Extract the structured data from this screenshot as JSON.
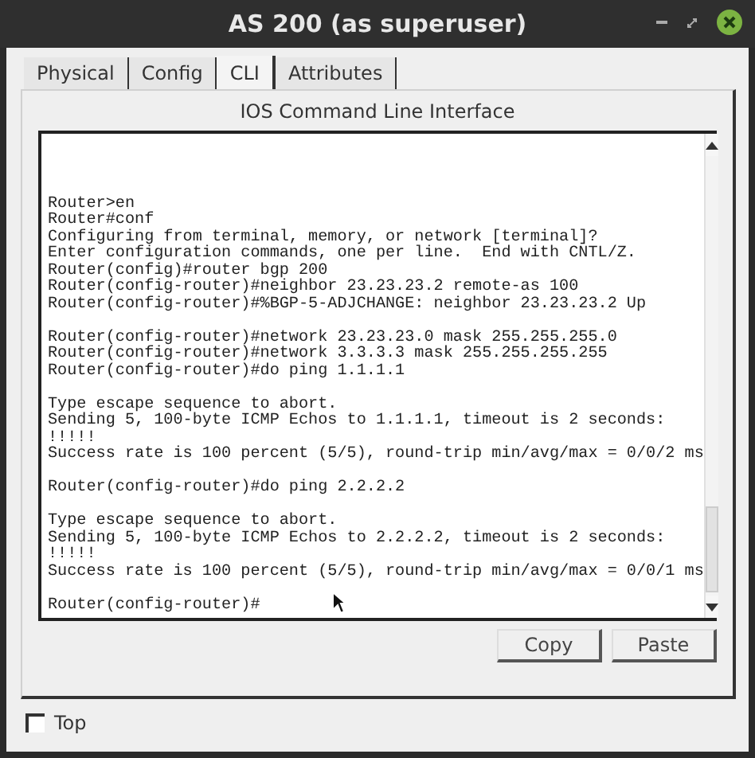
{
  "window": {
    "title": "AS 200 (as superuser)"
  },
  "tabs": [
    {
      "label": "Physical",
      "selected": false
    },
    {
      "label": "Config",
      "selected": false
    },
    {
      "label": "CLI",
      "selected": true
    },
    {
      "label": "Attributes",
      "selected": false
    }
  ],
  "cli": {
    "heading": "IOS Command Line Interface",
    "paragraphs": [
      [
        "Router>en",
        "Router#conf",
        "Configuring from terminal, memory, or network [terminal]?",
        "Enter configuration commands, one per line.  End with CNTL/Z.",
        "Router(config)#router bgp 200",
        "Router(config-router)#neighbor 23.23.23.2 remote-as 100",
        "Router(config-router)#%BGP-5-ADJCHANGE: neighbor 23.23.23.2 Up"
      ],
      [
        "Router(config-router)#network 23.23.23.0 mask 255.255.255.0",
        "Router(config-router)#network 3.3.3.3 mask 255.255.255.255",
        "Router(config-router)#do ping 1.1.1.1"
      ],
      [
        "Type escape sequence to abort.",
        "Sending 5, 100-byte ICMP Echos to 1.1.1.1, timeout is 2 seconds:",
        "!!!!!",
        "Success rate is 100 percent (5/5), round-trip min/avg/max = 0/0/2 ms"
      ],
      [
        "Router(config-router)#do ping 2.2.2.2"
      ],
      [
        "Type escape sequence to abort.",
        "Sending 5, 100-byte ICMP Echos to 2.2.2.2, timeout is 2 seconds:",
        "!!!!!",
        "Success rate is 100 percent (5/5), round-trip min/avg/max = 0/0/1 ms"
      ],
      [
        "Router(config-router)#"
      ]
    ],
    "buttons": [
      "Copy",
      "Paste"
    ]
  },
  "top_checkbox": {
    "label": "Top",
    "checked": false
  }
}
